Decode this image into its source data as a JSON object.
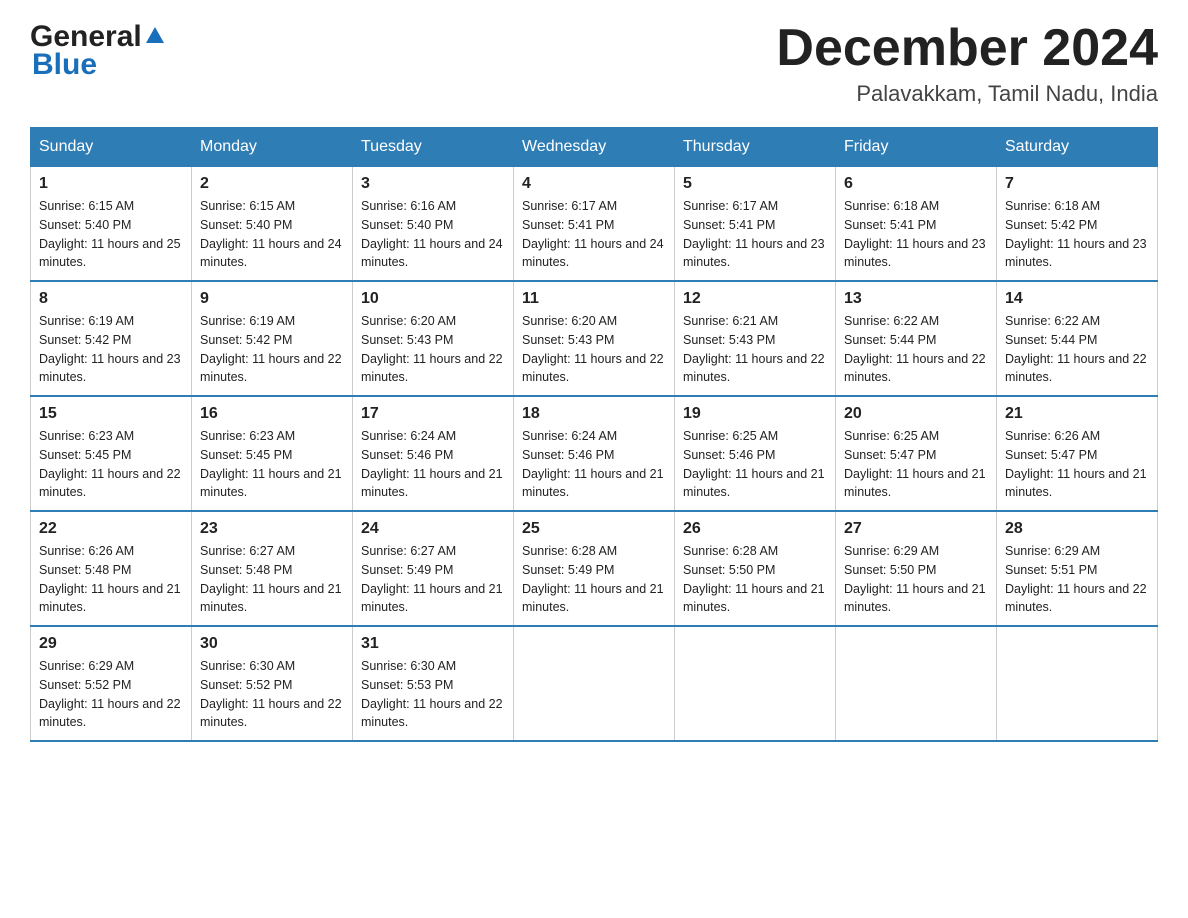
{
  "header": {
    "logo_general": "General",
    "logo_blue": "Blue",
    "month": "December 2024",
    "location": "Palavakkam, Tamil Nadu, India"
  },
  "weekdays": [
    "Sunday",
    "Monday",
    "Tuesday",
    "Wednesday",
    "Thursday",
    "Friday",
    "Saturday"
  ],
  "weeks": [
    [
      {
        "day": "1",
        "sunrise": "6:15 AM",
        "sunset": "5:40 PM",
        "daylight": "11 hours and 25 minutes."
      },
      {
        "day": "2",
        "sunrise": "6:15 AM",
        "sunset": "5:40 PM",
        "daylight": "11 hours and 24 minutes."
      },
      {
        "day": "3",
        "sunrise": "6:16 AM",
        "sunset": "5:40 PM",
        "daylight": "11 hours and 24 minutes."
      },
      {
        "day": "4",
        "sunrise": "6:17 AM",
        "sunset": "5:41 PM",
        "daylight": "11 hours and 24 minutes."
      },
      {
        "day": "5",
        "sunrise": "6:17 AM",
        "sunset": "5:41 PM",
        "daylight": "11 hours and 23 minutes."
      },
      {
        "day": "6",
        "sunrise": "6:18 AM",
        "sunset": "5:41 PM",
        "daylight": "11 hours and 23 minutes."
      },
      {
        "day": "7",
        "sunrise": "6:18 AM",
        "sunset": "5:42 PM",
        "daylight": "11 hours and 23 minutes."
      }
    ],
    [
      {
        "day": "8",
        "sunrise": "6:19 AM",
        "sunset": "5:42 PM",
        "daylight": "11 hours and 23 minutes."
      },
      {
        "day": "9",
        "sunrise": "6:19 AM",
        "sunset": "5:42 PM",
        "daylight": "11 hours and 22 minutes."
      },
      {
        "day": "10",
        "sunrise": "6:20 AM",
        "sunset": "5:43 PM",
        "daylight": "11 hours and 22 minutes."
      },
      {
        "day": "11",
        "sunrise": "6:20 AM",
        "sunset": "5:43 PM",
        "daylight": "11 hours and 22 minutes."
      },
      {
        "day": "12",
        "sunrise": "6:21 AM",
        "sunset": "5:43 PM",
        "daylight": "11 hours and 22 minutes."
      },
      {
        "day": "13",
        "sunrise": "6:22 AM",
        "sunset": "5:44 PM",
        "daylight": "11 hours and 22 minutes."
      },
      {
        "day": "14",
        "sunrise": "6:22 AM",
        "sunset": "5:44 PM",
        "daylight": "11 hours and 22 minutes."
      }
    ],
    [
      {
        "day": "15",
        "sunrise": "6:23 AM",
        "sunset": "5:45 PM",
        "daylight": "11 hours and 22 minutes."
      },
      {
        "day": "16",
        "sunrise": "6:23 AM",
        "sunset": "5:45 PM",
        "daylight": "11 hours and 21 minutes."
      },
      {
        "day": "17",
        "sunrise": "6:24 AM",
        "sunset": "5:46 PM",
        "daylight": "11 hours and 21 minutes."
      },
      {
        "day": "18",
        "sunrise": "6:24 AM",
        "sunset": "5:46 PM",
        "daylight": "11 hours and 21 minutes."
      },
      {
        "day": "19",
        "sunrise": "6:25 AM",
        "sunset": "5:46 PM",
        "daylight": "11 hours and 21 minutes."
      },
      {
        "day": "20",
        "sunrise": "6:25 AM",
        "sunset": "5:47 PM",
        "daylight": "11 hours and 21 minutes."
      },
      {
        "day": "21",
        "sunrise": "6:26 AM",
        "sunset": "5:47 PM",
        "daylight": "11 hours and 21 minutes."
      }
    ],
    [
      {
        "day": "22",
        "sunrise": "6:26 AM",
        "sunset": "5:48 PM",
        "daylight": "11 hours and 21 minutes."
      },
      {
        "day": "23",
        "sunrise": "6:27 AM",
        "sunset": "5:48 PM",
        "daylight": "11 hours and 21 minutes."
      },
      {
        "day": "24",
        "sunrise": "6:27 AM",
        "sunset": "5:49 PM",
        "daylight": "11 hours and 21 minutes."
      },
      {
        "day": "25",
        "sunrise": "6:28 AM",
        "sunset": "5:49 PM",
        "daylight": "11 hours and 21 minutes."
      },
      {
        "day": "26",
        "sunrise": "6:28 AM",
        "sunset": "5:50 PM",
        "daylight": "11 hours and 21 minutes."
      },
      {
        "day": "27",
        "sunrise": "6:29 AM",
        "sunset": "5:50 PM",
        "daylight": "11 hours and 21 minutes."
      },
      {
        "day": "28",
        "sunrise": "6:29 AM",
        "sunset": "5:51 PM",
        "daylight": "11 hours and 22 minutes."
      }
    ],
    [
      {
        "day": "29",
        "sunrise": "6:29 AM",
        "sunset": "5:52 PM",
        "daylight": "11 hours and 22 minutes."
      },
      {
        "day": "30",
        "sunrise": "6:30 AM",
        "sunset": "5:52 PM",
        "daylight": "11 hours and 22 minutes."
      },
      {
        "day": "31",
        "sunrise": "6:30 AM",
        "sunset": "5:53 PM",
        "daylight": "11 hours and 22 minutes."
      },
      null,
      null,
      null,
      null
    ]
  ]
}
